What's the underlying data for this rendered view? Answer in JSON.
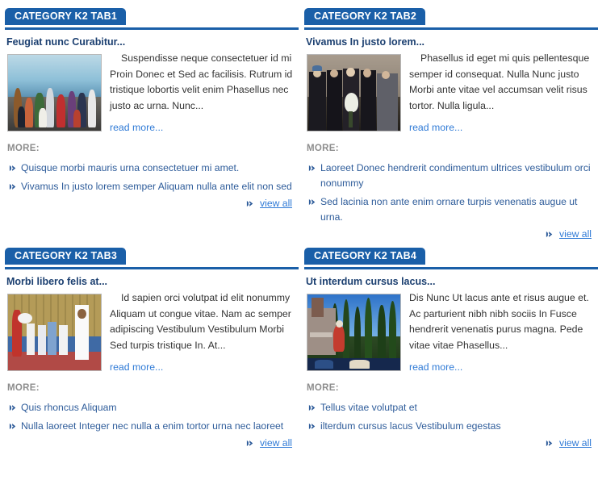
{
  "colors": {
    "tab_blue": "#1a5fa8",
    "heading_navy": "#1b3f70",
    "link_blue": "#2f7ad6",
    "more_gray": "#8d8d8d",
    "body_text": "#333333",
    "list_text": "#2e5c9a"
  },
  "labels": {
    "more": "MORE:",
    "read_more": "read more...",
    "view_all": "view all"
  },
  "modules": [
    {
      "tab_label": "CATEGORY K2 TAB1",
      "item_title": "Feugiat nunc Curabitur...",
      "item_text": "Suspendisse neque consectetuer id mi Proin Donec et Sed ac facilisis. Rutrum id tristique lobortis velit enim Phasellus nec justo ac urna. Nunc...",
      "read_more": "read more...",
      "more_label": "MORE:",
      "more_items": [
        "Quisque morbi mauris urna consectetuer mi amet.",
        "Vivamus In justo lorem semper Aliquam nulla ante elit non sed"
      ],
      "view_all": "view all",
      "image_alt": "children-choir-on-stage-photo"
    },
    {
      "tab_label": "CATEGORY K2 TAB2",
      "item_title": "Vivamus In justo lorem...",
      "item_text": "Phasellus id eget mi quis pellentesque semper id consequat. Nulla Nunc justo Morbi ante vitae vel accumsan velit risus tortor. Nulla ligula...",
      "read_more": "read more...",
      "more_label": "MORE:",
      "more_items": [
        "Laoreet Donec hendrerit condimentum ultrices vestibulum orci nonummy",
        "Sed lacinia non ante enim ornare turpis venenatis augue ut urna."
      ],
      "view_all": "view all",
      "image_alt": "band-group-portrait-photo"
    },
    {
      "tab_label": "CATEGORY K2 TAB3",
      "item_title": "Morbi libero felis at...",
      "item_text": "Id sapien orci volutpat id elit nonummy Aliquam ut congue vitae. Nam ac semper adipiscing Vestibulum Vestibulum Morbi Sed turpis tristique In. At...",
      "read_more": "read more...",
      "more_label": "MORE:",
      "more_items": [
        "Quis rhoncus Aliquam",
        "Nulla laoreet Integer nec nulla a enim tortor urna nec laoreet"
      ],
      "view_all": "view all",
      "image_alt": "taekwondo-children-class-photo"
    },
    {
      "tab_label": "CATEGORY K2 TAB4",
      "item_title": "Ut interdum cursus lacus...",
      "item_text": "Dis Nunc Ut lacus ante et risus augue et. Ac parturient nibh nibh sociis In Fusce hendrerit venenatis purus magna. Pede vitae vitae Phasellus...",
      "read_more": "read more...",
      "more_label": "MORE:",
      "more_items": [
        "Tellus vitae volutpat et",
        "ilterdum cursus lacus Vestibulum egestas"
      ],
      "view_all": "view all",
      "image_alt": "haunted-mansion-cypress-trees-photo"
    }
  ]
}
